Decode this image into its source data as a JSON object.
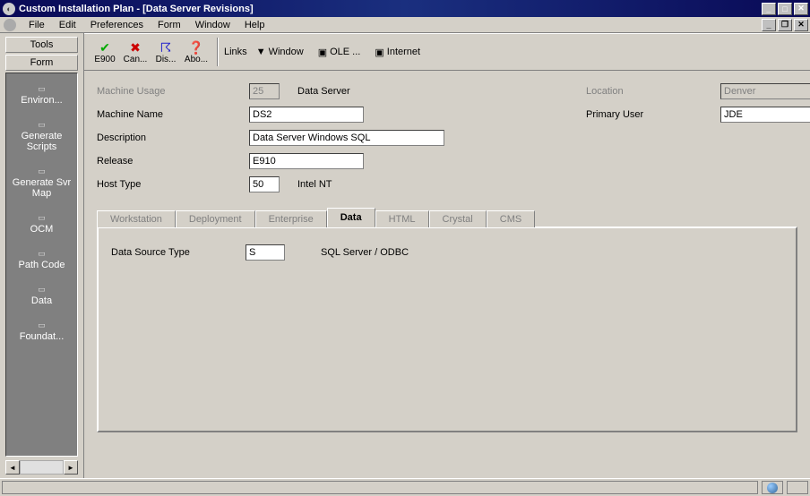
{
  "window": {
    "title": "Custom Installation Plan - [Data Server Revisions]"
  },
  "menu": {
    "file": "File",
    "edit": "Edit",
    "prefs": "Preferences",
    "form": "Form",
    "window": "Window",
    "help": "Help"
  },
  "sidebar": {
    "tools": "Tools",
    "form": "Form",
    "items": [
      "Environ...",
      "Generate Scripts",
      "Generate Svr Map",
      "OCM",
      "Path Code",
      "Data",
      "Foundat..."
    ]
  },
  "toolbar": {
    "e900": "E900",
    "cancel": "Can...",
    "dis": "Dis...",
    "abo": "Abo...",
    "links": "Links",
    "window": "Window",
    "ole": "OLE ...",
    "internet": "Internet"
  },
  "fields": {
    "machine_usage_lbl": "Machine Usage",
    "machine_usage": "25",
    "machine_usage_txt": "Data Server",
    "location_lbl": "Location",
    "location": "Denver",
    "machine_name_lbl": "Machine Name",
    "machine_name": "DS2",
    "primary_user_lbl": "Primary User",
    "primary_user": "JDE",
    "description_lbl": "Description",
    "description": "Data Server Windows SQL",
    "release_lbl": "Release",
    "release": "E910",
    "host_type_lbl": "Host Type",
    "host_type": "50",
    "host_type_txt": "Intel NT"
  },
  "tabs": {
    "workstation": "Workstation",
    "deployment": "Deployment",
    "enterprise": "Enterprise",
    "data": "Data",
    "html": "HTML",
    "crystal": "Crystal",
    "cms": "CMS"
  },
  "tabbody": {
    "ds_type_lbl": "Data Source Type",
    "ds_type": "S",
    "ds_type_txt": "SQL Server / ODBC"
  }
}
